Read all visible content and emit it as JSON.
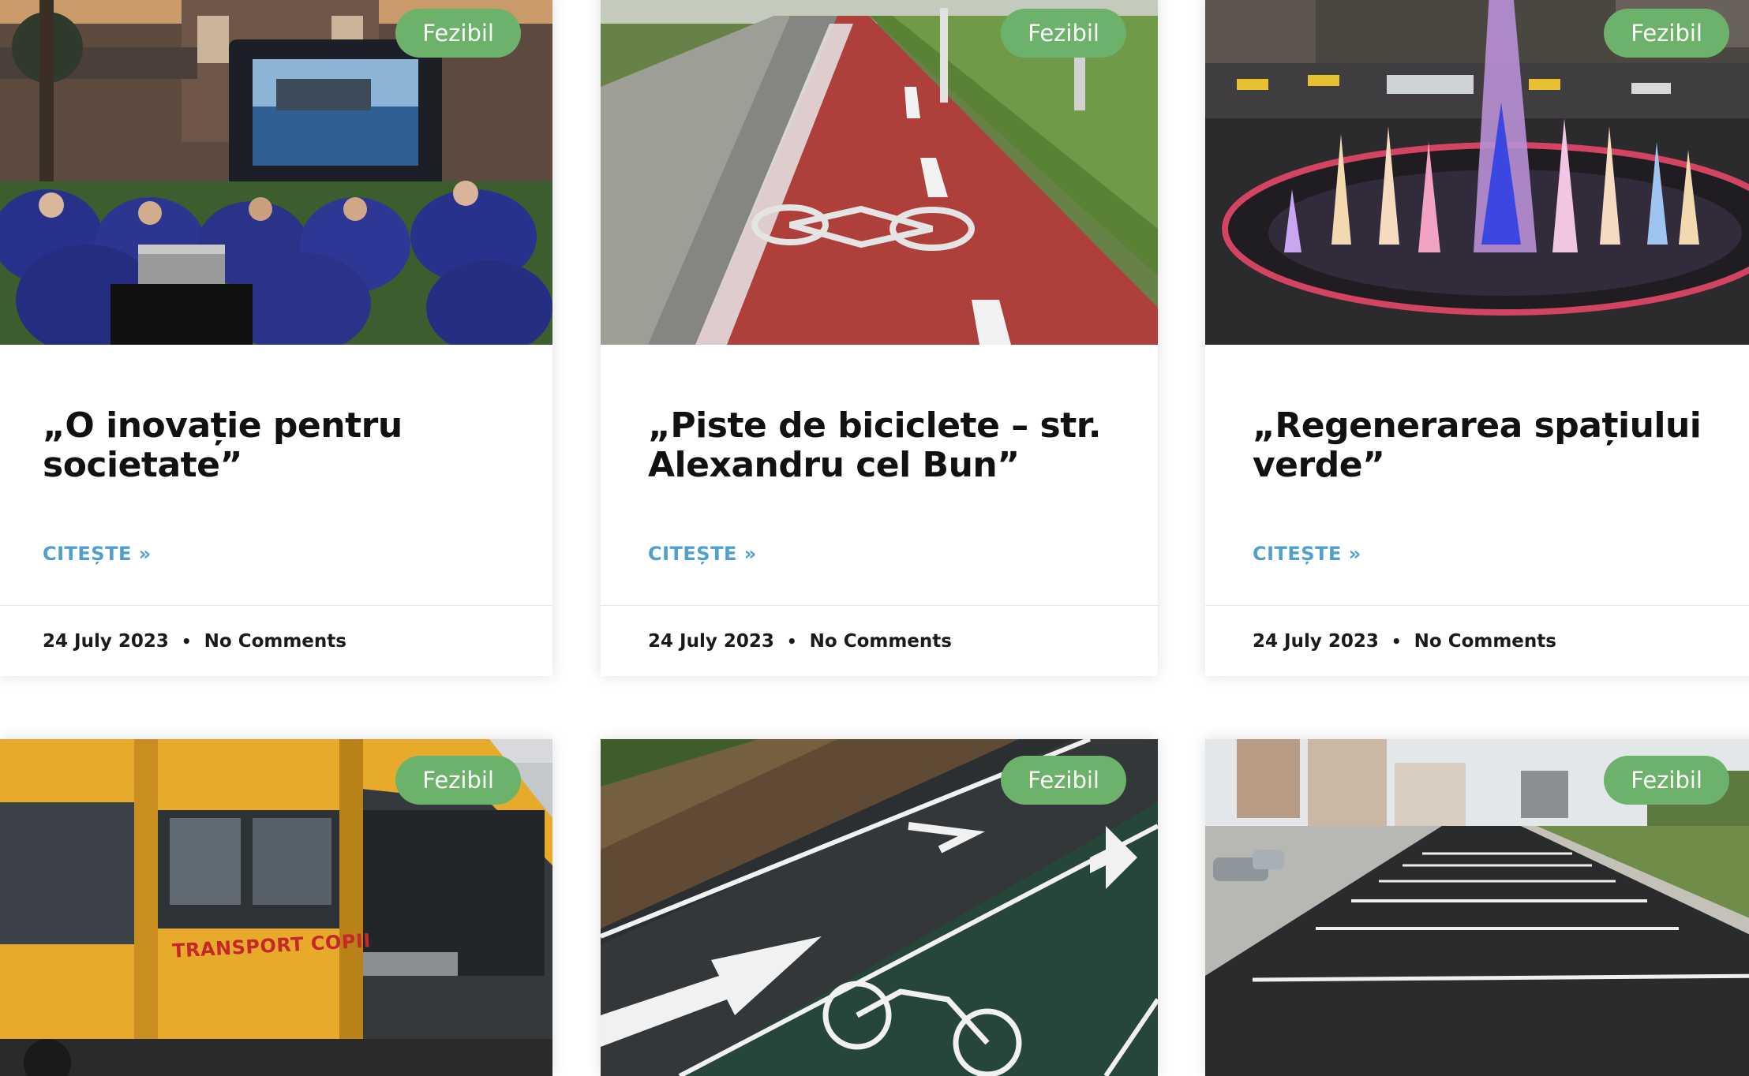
{
  "posts": [
    {
      "badge": "Fezibil",
      "title": "„O inovație pentru societate”",
      "read_more": "CITEȘTE »",
      "date": "24 July 2023",
      "separator": "•",
      "comments": "No Comments",
      "image": "outdoor-cinema-photo"
    },
    {
      "badge": "Fezibil",
      "title": "„Piste de biciclete – str. Alexandru cel Bun”",
      "read_more": "CITEȘTE »",
      "date": "24 July 2023",
      "separator": "•",
      "comments": "No Comments",
      "image": "red-bike-lane-photo"
    },
    {
      "badge": "Fezibil",
      "title": "„Regenerarea spațiului verde”",
      "read_more": "CITEȘTE »",
      "date": "24 July 2023",
      "separator": "•",
      "comments": "No Comments",
      "image": "illuminated-fountain-photo"
    },
    {
      "badge": "Fezibil",
      "image": "school-minibus-photo",
      "vehicle_text": "TRANSPORT COPII"
    },
    {
      "badge": "Fezibil",
      "image": "green-bike-lane-photo"
    },
    {
      "badge": "Fezibil",
      "image": "parking-lot-photo"
    }
  ],
  "colors": {
    "badge": "#6db26a",
    "link": "#4f9fd0",
    "title": "#111111"
  }
}
